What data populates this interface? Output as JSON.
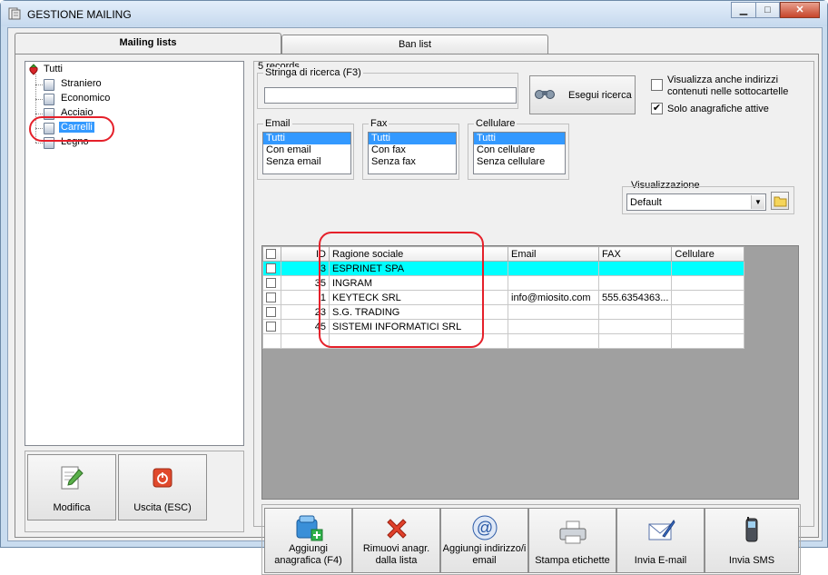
{
  "window": {
    "title": "GESTIONE MAILING",
    "min": "▁",
    "max": "□",
    "close": "✕"
  },
  "tabs": [
    {
      "label": "Mailing lists"
    },
    {
      "label": "Ban list"
    }
  ],
  "tree": {
    "root": "Tutti",
    "items": [
      "Straniero",
      "Economico",
      "Acciaio",
      "Carrelli",
      "Legno"
    ],
    "selected": "Carrelli"
  },
  "left_buttons": {
    "modifica": "Modifica",
    "uscita": "Uscita (ESC)"
  },
  "records": "5 records",
  "search": {
    "label": "Stringa di ricerca (F3)",
    "value": "",
    "button": "Esegui ricerca"
  },
  "options": {
    "subfolders_label_1": "Visualizza anche indirizzi",
    "subfolders_label_2": "contenuti nelle sottocartelle",
    "subfolders_checked": false,
    "active_label": "Solo anagrafiche attive",
    "active_checked": true,
    "check_mark": "✔"
  },
  "filters": {
    "email": {
      "title": "Email",
      "options": [
        "Tutti",
        "Con email",
        "Senza email"
      ],
      "selected": 0
    },
    "fax": {
      "title": "Fax",
      "options": [
        "Tutti",
        "Con fax",
        "Senza fax"
      ],
      "selected": 0
    },
    "cellulare": {
      "title": "Cellulare",
      "options": [
        "Tutti",
        "Con cellulare",
        "Senza cellulare"
      ],
      "selected": 0
    }
  },
  "view": {
    "label": "Visualizzazione",
    "value": "Default",
    "arrow": "▼"
  },
  "table": {
    "columns": [
      "",
      "ID",
      "Ragione sociale",
      "Email",
      "FAX",
      "Cellulare"
    ],
    "rows": [
      {
        "id": "3",
        "name": "ESPRINET SPA",
        "email": "",
        "fax": "",
        "cell": ""
      },
      {
        "id": "35",
        "name": "INGRAM",
        "email": "",
        "fax": "",
        "cell": ""
      },
      {
        "id": "1",
        "name": "KEYTECK SRL",
        "email": "info@miosito.com",
        "fax": "555.6354363...",
        "cell": ""
      },
      {
        "id": "23",
        "name": "S.G. TRADING",
        "email": "",
        "fax": "",
        "cell": ""
      },
      {
        "id": "45",
        "name": "SISTEMI INFORMATICI SRL",
        "email": "",
        "fax": "",
        "cell": ""
      }
    ],
    "highlight_color": "#00ffff"
  },
  "actions": [
    {
      "l1": "Aggiungi",
      "l2": "anagrafica (F4)"
    },
    {
      "l1": "Rimuovi anagr.",
      "l2": "dalla lista"
    },
    {
      "l1": "Aggiungi indirizzo/i",
      "l2": "email"
    },
    {
      "l1": "Stampa etichette",
      "l2": ""
    },
    {
      "l1": "Invia E-mail",
      "l2": ""
    },
    {
      "l1": "Invia SMS",
      "l2": ""
    }
  ],
  "colors": {
    "selection": "#3399ff",
    "annotation": "#e5202a"
  }
}
